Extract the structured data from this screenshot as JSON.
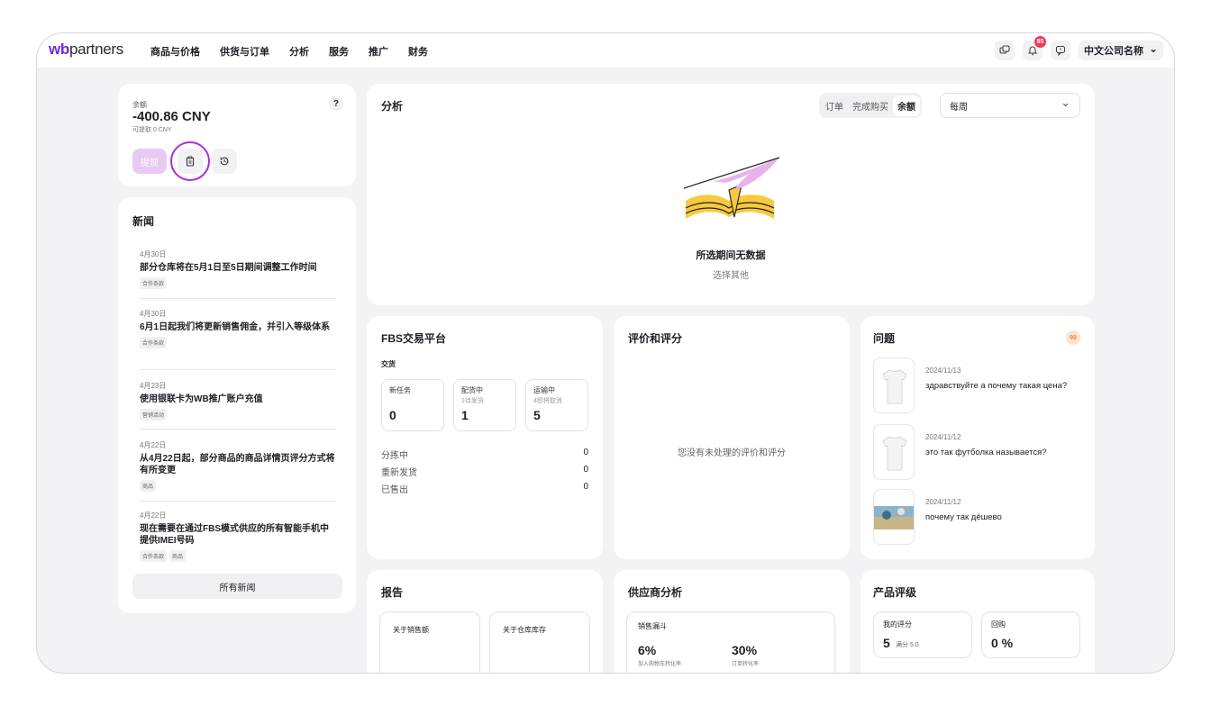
{
  "brand": {
    "wb": "wb",
    "rest": "partners"
  },
  "nav": [
    "商品与价格",
    "供货与订单",
    "分析",
    "服务",
    "推广",
    "财务"
  ],
  "topbar": {
    "notif_count": "85",
    "company": "中文公司名称",
    "chevron": "⌄"
  },
  "balance": {
    "label": "余额",
    "value": "-400.86 CNY",
    "sub": "可提取 0 CNY",
    "help": "?",
    "withdraw": "提现"
  },
  "news": {
    "title": "新闻",
    "items": [
      {
        "date": "4月30日",
        "title": "部分仓库将在5月1日至5日期间调整工作时间",
        "tags": [
          "合作条款"
        ]
      },
      {
        "date": "4月30日",
        "title": "6月1日起我们将更新销售佣金，并引入等级体系",
        "tags": [
          "合作条款"
        ]
      },
      {
        "date": "4月23日",
        "title": "使用银联卡为WB推广账户充值",
        "tags": [
          "营销活动"
        ]
      },
      {
        "date": "4月22日",
        "title": "从4月22日起，部分商品的商品详情页评分方式将有所变更",
        "tags": [
          "商品"
        ]
      },
      {
        "date": "4月22日",
        "title": "现在需要在通过FBS模式供应的所有智能手机中提供IMEI号码",
        "tags": [
          "合作条款",
          "商品"
        ]
      }
    ],
    "all_button": "所有新闻"
  },
  "analytics": {
    "title": "分析",
    "tabs": [
      "订单",
      "完成购买",
      "余额"
    ],
    "active_tab": "余额",
    "period": "每周",
    "empty_title": "所选期间无数据",
    "empty_sub": "选择其他"
  },
  "fbs": {
    "title": "FBS交易平台",
    "subtitle": "交货",
    "boxes": [
      {
        "label": "新任务",
        "sub": "",
        "value": "0"
      },
      {
        "label": "配货中",
        "sub": "1待发货",
        "value": "1"
      },
      {
        "label": "运输中",
        "sub": "4即将取消",
        "value": "5"
      }
    ],
    "rows": [
      {
        "label": "分拣中",
        "value": "0"
      },
      {
        "label": "重新发货",
        "value": "0"
      },
      {
        "label": "已售出",
        "value": "0"
      }
    ]
  },
  "reviews": {
    "title": "评价和评分",
    "empty": "您没有未处理的评价和评分"
  },
  "questions": {
    "title": "问题",
    "count": "99",
    "items": [
      {
        "date": "2024/11/13",
        "text": "здравствуйте а почему такая цена?"
      },
      {
        "date": "2024/11/12",
        "text": "это так футболка называется?"
      },
      {
        "date": "2024/11/12",
        "text": "почему так дёшево"
      }
    ]
  },
  "reports": {
    "title": "报告",
    "items": [
      "关于销售额",
      "关于仓库库存"
    ]
  },
  "supplier": {
    "title": "供应商分析",
    "funnel_title": "销售漏斗",
    "metrics": [
      {
        "value": "6%",
        "label": "加入购物车转化率"
      },
      {
        "value": "30%",
        "label": "订单转化率"
      }
    ]
  },
  "rating": {
    "title": "产品评级",
    "my_score_label": "我的评分",
    "my_score": "5",
    "my_score_max": "满分 5.0",
    "repurchase_label": "回购",
    "repurchase": "0 %"
  },
  "colors": {
    "accent": "#6b2bdf",
    "highlight_ring": "#b02cd9",
    "badge": "#f0365a",
    "withdraw_bg": "#e8c9f3"
  }
}
